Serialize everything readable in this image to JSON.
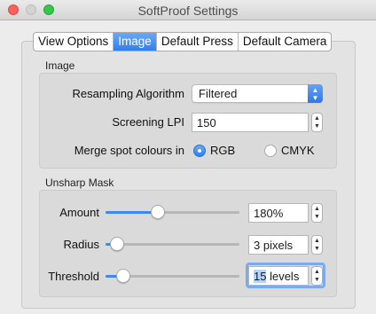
{
  "window": {
    "title": "SoftProof Settings"
  },
  "tabs": [
    {
      "label": "View Options",
      "active": false
    },
    {
      "label": "Image",
      "active": true
    },
    {
      "label": "Default Press",
      "active": false
    },
    {
      "label": "Default Camera",
      "active": false
    }
  ],
  "image_group": {
    "title": "Image",
    "resampling_label": "Resampling Algorithm",
    "resampling_value": "Filtered",
    "screening_label": "Screening LPI",
    "screening_value": "150",
    "merge_label": "Merge spot colours in",
    "merge_options": [
      {
        "label": "RGB",
        "selected": true
      },
      {
        "label": "CMYK",
        "selected": false
      }
    ]
  },
  "unsharp_group": {
    "title": "Unsharp Mask",
    "amount_label": "Amount",
    "amount_value": "180%",
    "amount_level": 0.38,
    "radius_label": "Radius",
    "radius_value": "3 pixels",
    "radius_level": 0.04,
    "threshold_label": "Threshold",
    "threshold_value_selected": "15",
    "threshold_value_rest": " levels",
    "threshold_level": 0.09
  },
  "colors": {
    "accent": "#2f7ff2",
    "focus": "#7aaaf0"
  }
}
